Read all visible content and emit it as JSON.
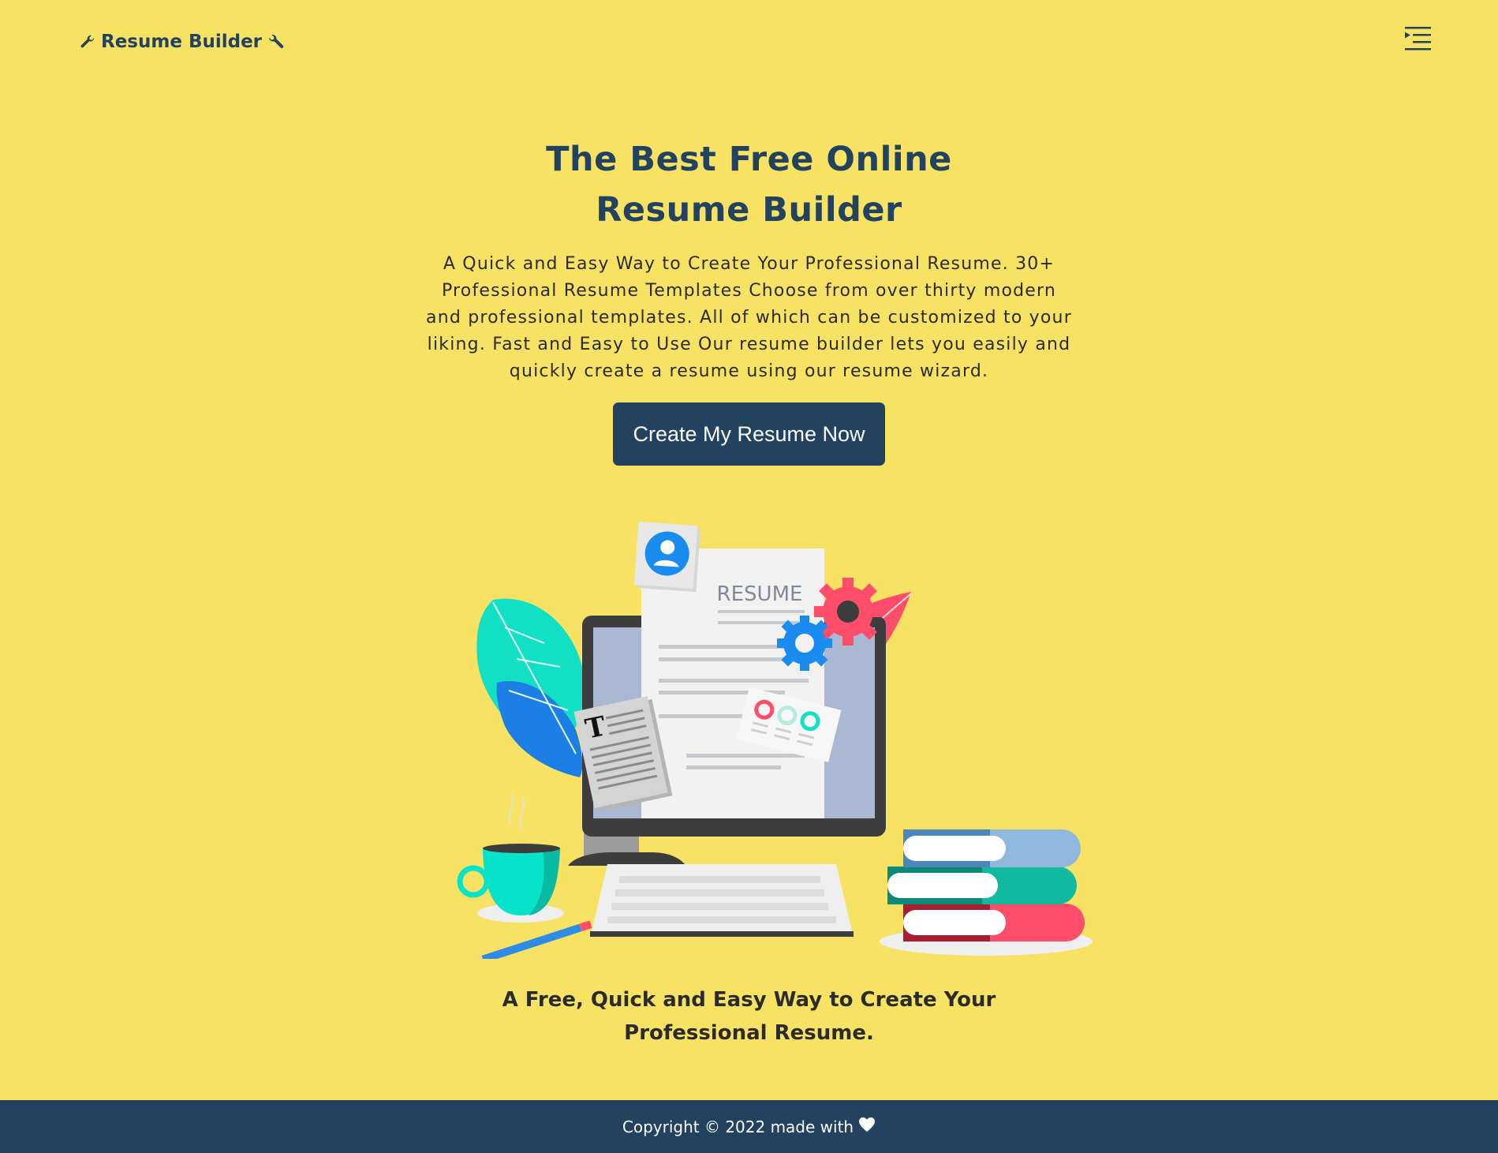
{
  "nav": {
    "brand": "Resume Builder",
    "brand_icon_left": "wrench-icon",
    "brand_icon_right": "wrench-icon",
    "menu_icon": "menu-indent-icon"
  },
  "hero": {
    "title": "The Best Free Online Resume Builder",
    "description": "A Quick and Easy Way to Create Your Professional Resume. 30+ Professional Resume Templates Choose from over thirty modern and professional templates. All of which can be customized to your liking. Fast and Easy to Use Our resume builder lets you easily and quickly create a resume using our resume wizard.",
    "cta_label": "Create My Resume Now"
  },
  "illustration": {
    "resume_heading": "RESUME",
    "text_card_letter": "T"
  },
  "tagline": "A Free, Quick and Easy Way to Create Your Professional Resume.",
  "footer": {
    "text": "Copyright © 2022 made with",
    "icon": "heart-icon"
  },
  "colors": {
    "background": "#f7e264",
    "primary": "#22425f",
    "button_text": "#ffffff"
  }
}
